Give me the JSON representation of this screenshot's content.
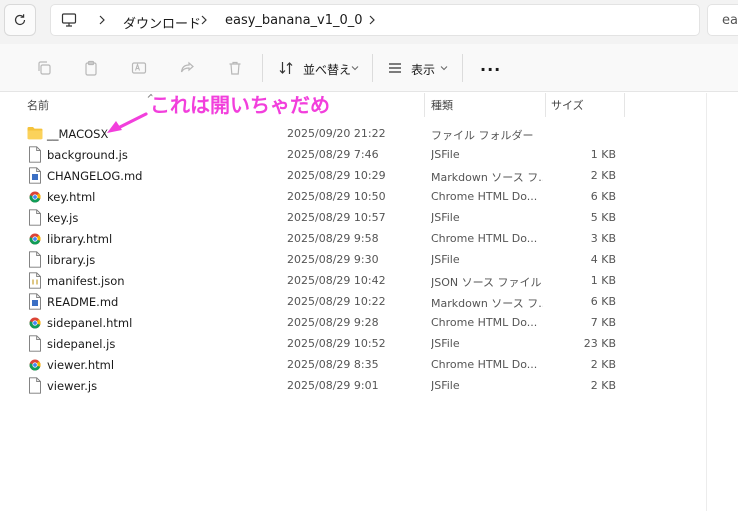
{
  "address_bar": {
    "crumbs": [
      "ダウンロード",
      "easy_banana_v1_0_0"
    ],
    "search_partial": "ea"
  },
  "toolbar": {
    "sort_label": "並べ替え",
    "view_label": "表示",
    "more_label": "..."
  },
  "columns": {
    "name": "名前",
    "type": "種類",
    "size": "サイズ"
  },
  "annotation": {
    "text": "これは開いちゃだめ",
    "color": "#f23fdc"
  },
  "files": [
    {
      "name": "__MACOSX",
      "date": "2025/09/20 21:22",
      "type": "ファイル フォルダー",
      "size": "",
      "icon": "folder-icon"
    },
    {
      "name": "background.js",
      "date": "2025/08/29 7:46",
      "type": "JSFile",
      "size": "1 KB",
      "icon": "file-icon"
    },
    {
      "name": "CHANGELOG.md",
      "date": "2025/08/29 10:29",
      "type": "Markdown ソース フ...",
      "size": "2 KB",
      "icon": "markdown-file-icon"
    },
    {
      "name": "key.html",
      "date": "2025/08/29 10:50",
      "type": "Chrome HTML Do...",
      "size": "6 KB",
      "icon": "chrome-html-icon"
    },
    {
      "name": "key.js",
      "date": "2025/08/29 10:57",
      "type": "JSFile",
      "size": "5 KB",
      "icon": "file-icon"
    },
    {
      "name": "library.html",
      "date": "2025/08/29 9:58",
      "type": "Chrome HTML Do...",
      "size": "3 KB",
      "icon": "chrome-html-icon"
    },
    {
      "name": "library.js",
      "date": "2025/08/29 9:30",
      "type": "JSFile",
      "size": "4 KB",
      "icon": "file-icon"
    },
    {
      "name": "manifest.json",
      "date": "2025/08/29 10:42",
      "type": "JSON ソース ファイル",
      "size": "1 KB",
      "icon": "json-file-icon"
    },
    {
      "name": "README.md",
      "date": "2025/08/29 10:22",
      "type": "Markdown ソース フ...",
      "size": "6 KB",
      "icon": "markdown-file-icon"
    },
    {
      "name": "sidepanel.html",
      "date": "2025/08/29 9:28",
      "type": "Chrome HTML Do...",
      "size": "7 KB",
      "icon": "chrome-html-icon"
    },
    {
      "name": "sidepanel.js",
      "date": "2025/08/29 10:52",
      "type": "JSFile",
      "size": "23 KB",
      "icon": "file-icon"
    },
    {
      "name": "viewer.html",
      "date": "2025/08/29 8:35",
      "type": "Chrome HTML Do...",
      "size": "2 KB",
      "icon": "chrome-html-icon"
    },
    {
      "name": "viewer.js",
      "date": "2025/08/29 9:01",
      "type": "JSFile",
      "size": "2 KB",
      "icon": "file-icon"
    }
  ]
}
